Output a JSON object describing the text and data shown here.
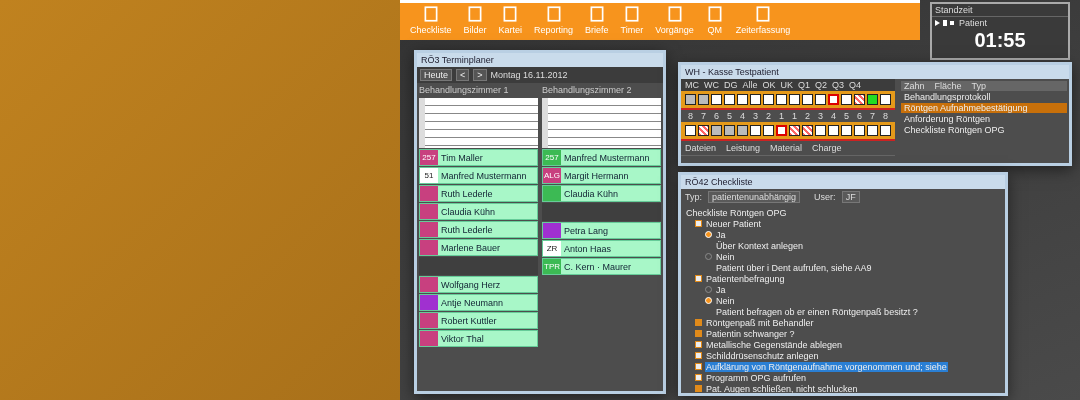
{
  "toolbar": {
    "items": [
      {
        "label": "Checkliste"
      },
      {
        "label": "Bilder"
      },
      {
        "label": "Kartei"
      },
      {
        "label": "Reporting"
      },
      {
        "label": "Briefe"
      },
      {
        "label": "Timer"
      },
      {
        "label": "Vorgänge"
      },
      {
        "label": "QM"
      },
      {
        "label": "Zeiterfassung"
      }
    ]
  },
  "timer": {
    "title": "Standzeit",
    "label": "Patient",
    "time": "01:55"
  },
  "planner": {
    "title": "RÖ3 Terminplaner",
    "date": "Montag 16.11.2012",
    "nav": [
      "Heute",
      "<",
      ">"
    ],
    "columns": [
      {
        "header": "Behandlungszimmer 1",
        "blocks": [
          {
            "kind": "free"
          },
          {
            "kind": "appointment",
            "code": "257",
            "color": "#c8407f",
            "name": "Tim Maller"
          },
          {
            "kind": "appointment",
            "code": "51",
            "color": "#ffffff",
            "name": "Manfred Mustermann"
          },
          {
            "kind": "appointment",
            "color": "#c8407f",
            "name": "Ruth Lederle"
          },
          {
            "kind": "appointment",
            "color": "#c8407f",
            "name": "Claudia Kühn"
          },
          {
            "kind": "appointment",
            "color": "#c8407f",
            "name": "Ruth Lederle"
          },
          {
            "kind": "appointment",
            "color": "#c8407f",
            "name": "Marlene Bauer"
          },
          {
            "kind": "blocked"
          },
          {
            "kind": "appointment",
            "color": "#c8407f",
            "name": "Wolfgang Herz"
          },
          {
            "kind": "appointment",
            "color": "#a030d0",
            "name": "Antje Neumann"
          },
          {
            "kind": "appointment",
            "color": "#c8407f",
            "name": "Robert Kuttler"
          },
          {
            "kind": "appointment",
            "color": "#c8407f",
            "name": "Viktor Thal"
          }
        ]
      },
      {
        "header": "Behandlungszimmer 2",
        "blocks": [
          {
            "kind": "free"
          },
          {
            "kind": "appointment",
            "code": "257",
            "color": "#3cba54",
            "name": "Manfred Mustermann"
          },
          {
            "kind": "appointment",
            "code": "ALG",
            "color": "#c8407f",
            "name": "Margit Hermann"
          },
          {
            "kind": "appointment",
            "color": "#3cba54",
            "name": "Claudia Kühn"
          },
          {
            "kind": "blocked"
          },
          {
            "kind": "appointment",
            "color": "#a030d0",
            "name": "Petra Lang"
          },
          {
            "kind": "appointment",
            "code": "ZR",
            "color": "#ffffff",
            "name": "Anton Haas"
          },
          {
            "kind": "appointment",
            "code": "TPR",
            "color": "#3cba54",
            "name": "C. Kern · Maurer"
          }
        ]
      }
    ]
  },
  "chart": {
    "title": "WH - Kasse Testpatient",
    "filters": [
      "MC",
      "WC",
      "DG",
      "Alle",
      "OK",
      "UK",
      "Q1",
      "Q2",
      "Q3",
      "Q4"
    ],
    "upper": [
      {
        "kind": "grey"
      },
      {
        "kind": "grey"
      },
      {
        "kind": "normal"
      },
      {
        "kind": "normal"
      },
      {
        "kind": "normal"
      },
      {
        "kind": "normal"
      },
      {
        "kind": "normal"
      },
      {
        "kind": "normal"
      },
      {
        "kind": "normal"
      },
      {
        "kind": "normal"
      },
      {
        "kind": "normal"
      },
      {
        "kind": "marked"
      },
      {
        "kind": "normal"
      },
      {
        "kind": "crossed"
      },
      {
        "kind": "green"
      },
      {
        "kind": "normal"
      }
    ],
    "numbers": [
      "8",
      "7",
      "6",
      "5",
      "4",
      "3",
      "2",
      "1",
      "1",
      "2",
      "3",
      "4",
      "5",
      "6",
      "7",
      "8"
    ],
    "lower": [
      {
        "kind": "normal"
      },
      {
        "kind": "crossed"
      },
      {
        "kind": "grey"
      },
      {
        "kind": "grey"
      },
      {
        "kind": "grey"
      },
      {
        "kind": "normal"
      },
      {
        "kind": "normal"
      },
      {
        "kind": "marked"
      },
      {
        "kind": "crossed"
      },
      {
        "kind": "crossed"
      },
      {
        "kind": "normal"
      },
      {
        "kind": "normal"
      },
      {
        "kind": "normal"
      },
      {
        "kind": "normal"
      },
      {
        "kind": "normal"
      },
      {
        "kind": "normal"
      }
    ],
    "tabs": [
      "Dateien",
      "Leistung",
      "Material",
      "Charge"
    ],
    "list_header": [
      "Zahn",
      "Fläche",
      "Typ"
    ],
    "documents": [
      {
        "label": "Behandlungsprotokoll",
        "selected": false
      },
      {
        "label": "Röntgen Aufnahmebestätigung",
        "selected": true
      },
      {
        "label": "Anforderung Röntgen",
        "selected": false
      },
      {
        "label": "Checkliste Röntgen OPG",
        "selected": false
      }
    ]
  },
  "checklist": {
    "title": "RÖ42 Checkliste",
    "fields": [
      {
        "label": "Typ:",
        "value": "patientenunabhängig"
      },
      {
        "label": "User:",
        "value": "JF"
      }
    ],
    "tree": [
      {
        "kind": "text",
        "label": "Checkliste Röntgen OPG",
        "selected": false,
        "children": [
          {
            "kind": "checkbox",
            "checked": false,
            "label": "Neuer Patient",
            "selected": false,
            "children": [
              {
                "kind": "radio",
                "checked": true,
                "label": "Ja",
                "selected": false,
                "children": [
                  {
                    "kind": "text",
                    "label": "Über Kontext anlegen",
                    "selected": false
                  }
                ]
              },
              {
                "kind": "radio",
                "checked": false,
                "label": "Nein",
                "selected": false,
                "children": [
                  {
                    "kind": "text",
                    "label": "Patient über i Dent aufrufen, siehe AA9",
                    "selected": false
                  }
                ]
              }
            ]
          },
          {
            "kind": "checkbox",
            "checked": false,
            "label": "Patientenbefragung",
            "selected": false,
            "children": [
              {
                "kind": "radio",
                "checked": false,
                "label": "Ja",
                "selected": false
              },
              {
                "kind": "radio",
                "checked": true,
                "label": "Nein",
                "selected": false,
                "children": [
                  {
                    "kind": "text",
                    "label": "Patient befragen ob er einen Röntgenpaß besitzt ?",
                    "selected": false
                  }
                ]
              }
            ]
          },
          {
            "kind": "checkbox",
            "checked": true,
            "label": "Röntgenpaß mit Behandler",
            "selected": false
          },
          {
            "kind": "checkbox",
            "checked": true,
            "label": "Patientin schwanger ?",
            "selected": false
          },
          {
            "kind": "checkbox",
            "checked": false,
            "label": "Metallische Gegenstände ablegen",
            "selected": false
          },
          {
            "kind": "checkbox",
            "checked": false,
            "label": "Schilddrüsenschutz anlegen",
            "selected": false
          },
          {
            "kind": "checkbox",
            "checked": false,
            "label": "Aufklärung von Röntgenaufnahme vorgenommen und; siehe",
            "selected": true
          },
          {
            "kind": "checkbox",
            "checked": false,
            "label": "Programm OPG aufrufen",
            "selected": false
          },
          {
            "kind": "checkbox",
            "checked": true,
            "label": "Pat. Augen schließen, nicht schlucken",
            "selected": false
          }
        ]
      }
    ]
  }
}
